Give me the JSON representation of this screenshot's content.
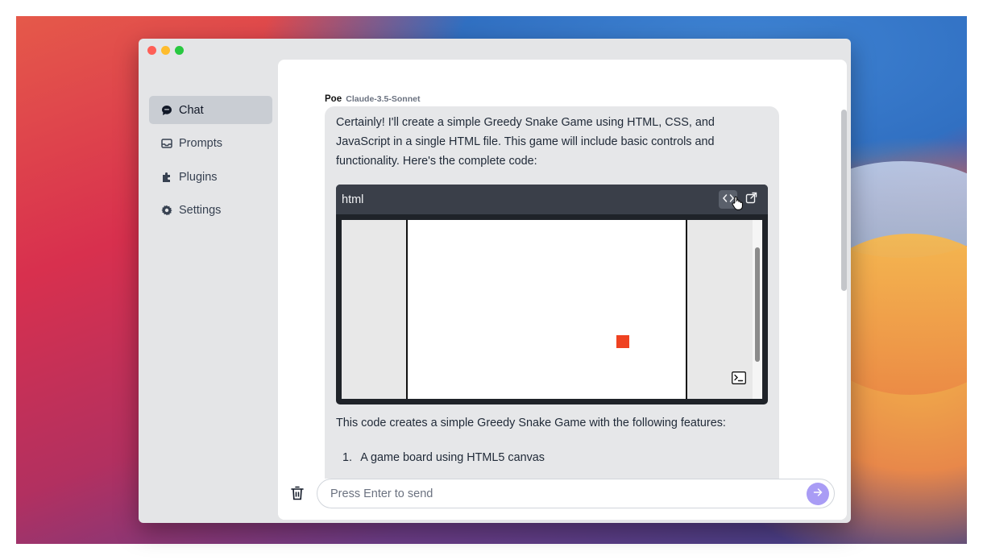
{
  "window": {
    "traffic_lights": [
      "close",
      "minimize",
      "maximize"
    ]
  },
  "sidebar": {
    "items": [
      {
        "label": "Chat",
        "icon": "chat-bubble-icon",
        "active": true
      },
      {
        "label": "Prompts",
        "icon": "inbox-icon",
        "active": false
      },
      {
        "label": "Plugins",
        "icon": "puzzle-icon",
        "active": false
      },
      {
        "label": "Settings",
        "icon": "gear-icon",
        "active": false
      }
    ]
  },
  "message": {
    "sender": "Poe",
    "model": "Claude-3.5-Sonnet",
    "intro": "Certainly! I'll create a simple Greedy Snake Game using HTML, CSS, and JavaScript in a single HTML file. This game will include basic controls and functionality. Here's the complete code:",
    "code_block": {
      "language": "html",
      "actions": [
        "code-view-icon",
        "open-external-icon"
      ],
      "preview": {
        "food_color": "#ef4221"
      }
    },
    "after_text": "This code creates a simple Greedy Snake Game with the following features:",
    "list": [
      {
        "num": "1.",
        "text": "A game board using HTML5 canvas"
      }
    ]
  },
  "composer": {
    "placeholder": "Press Enter to send",
    "send_color": "#a99cf5"
  }
}
